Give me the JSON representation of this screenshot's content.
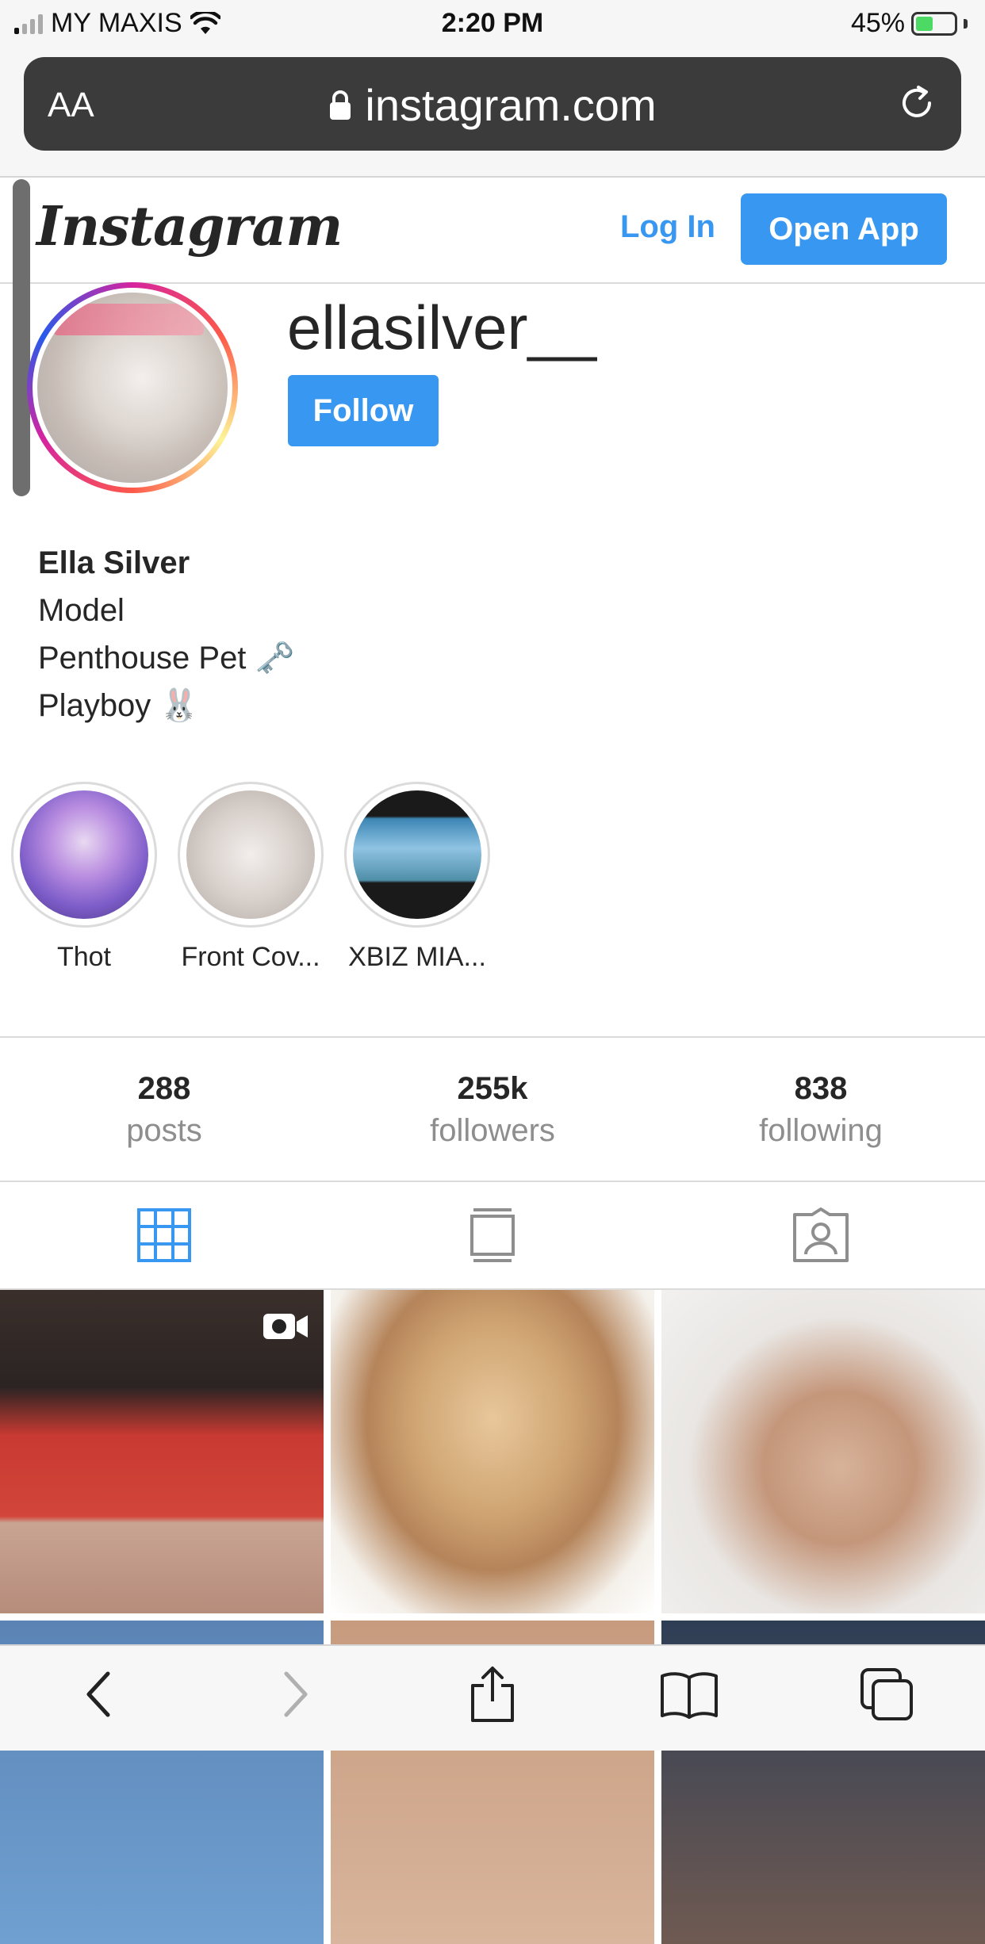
{
  "status_bar": {
    "carrier": "MY MAXIS",
    "time": "2:20 PM",
    "battery": "45%",
    "battery_level": 0.45
  },
  "browser": {
    "aa_label": "AA",
    "url": "instagram.com"
  },
  "header": {
    "logo_text": "Instagram",
    "login_label": "Log In",
    "open_app_label": "Open App"
  },
  "profile": {
    "username": "ellasilver__",
    "follow_label": "Follow",
    "full_name": "Ella Silver",
    "bio_lines": [
      "Model",
      "Penthouse Pet 🗝️",
      "Playboy 🐰"
    ]
  },
  "highlights": [
    {
      "label": "Thot"
    },
    {
      "label": "Front Cov..."
    },
    {
      "label": "XBIZ MIA..."
    }
  ],
  "stats": [
    {
      "value": "288",
      "label": "posts"
    },
    {
      "value": "255k",
      "label": "followers"
    },
    {
      "value": "838",
      "label": "following"
    }
  ],
  "tabs": [
    {
      "icon": "grid-icon",
      "active": true
    },
    {
      "icon": "feed-icon",
      "active": false
    },
    {
      "icon": "tagged-icon",
      "active": false
    }
  ],
  "colors": {
    "accent": "#3897f0",
    "text": "#262626",
    "muted": "#8e8e8e"
  }
}
